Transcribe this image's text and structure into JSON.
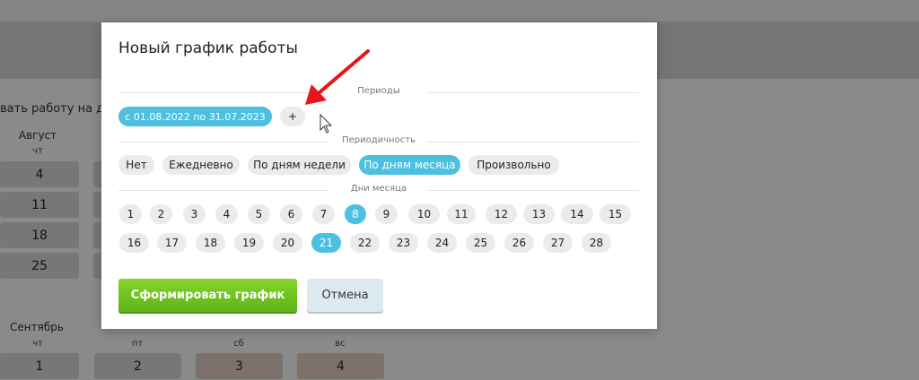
{
  "background": {
    "hint_text": "вать работу на дру",
    "month1": {
      "name": "Август",
      "dow": [
        "чт"
      ],
      "days": [
        "4",
        "11",
        "18",
        "25"
      ]
    },
    "month2": {
      "name": "Сентябрь",
      "dow": [
        "чт",
        "пт",
        "сб",
        "вс"
      ],
      "days": [
        "1",
        "2",
        "3",
        "4"
      ]
    }
  },
  "modal": {
    "title": "Новый график работы",
    "periods": {
      "label": "Периоды",
      "active_period": "с 01.08.2022 по 31.07.2023",
      "add_label": "+"
    },
    "periodicity": {
      "label": "Периодичность",
      "options": [
        "Нет",
        "Ежедневно",
        "По дням недели",
        "По дням месяца",
        "Произвольно"
      ],
      "selected": "По дням месяца"
    },
    "month_days": {
      "label": "Дни месяца",
      "row1": [
        "1",
        "2",
        "3",
        "4",
        "5",
        "6",
        "7",
        "8",
        "9",
        "10",
        "11",
        "12",
        "13",
        "14",
        "15"
      ],
      "row2": [
        "16",
        "17",
        "18",
        "19",
        "20",
        "21",
        "22",
        "23",
        "24",
        "25",
        "26",
        "27",
        "28"
      ],
      "selected": [
        "8",
        "21"
      ]
    },
    "actions": {
      "generate_label": "Сформировать график",
      "cancel_label": "Отмена"
    }
  },
  "colors": {
    "accent": "#4dc0e0",
    "primary_button": "#6cc020",
    "arrow": "#e8141b"
  }
}
